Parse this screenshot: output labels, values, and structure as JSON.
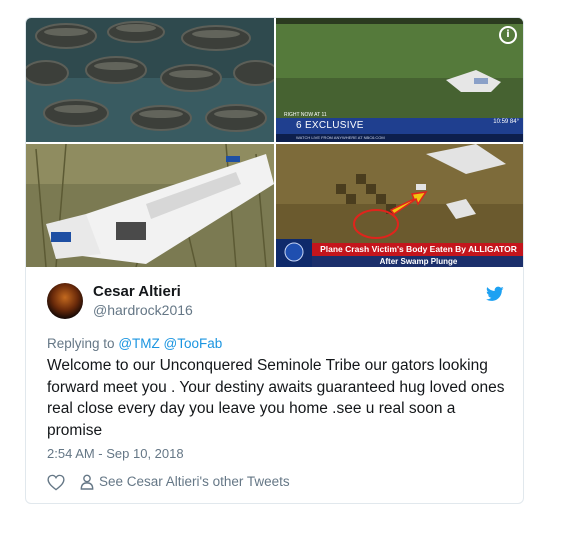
{
  "media": {
    "images": [
      {
        "icon": "alligators-photo"
      },
      {
        "icon": "swamp-crash-aerial-photo"
      },
      {
        "icon": "plane-wreck-photo"
      },
      {
        "icon": "crash-site-pixelated-photo"
      }
    ],
    "info_icon": "i",
    "news_bug": "6 EXCLUSIVE",
    "news_top": "RIGHT NOW AT 11",
    "news_sub": "WATCH LIVE FROM ANYWHERE AT NBC6.COM",
    "news_clock": "10:59  84°",
    "banner_headline": "Plane Crash Victim's Body Eaten By ALLIGATOR",
    "banner_sub": "After Swamp Plunge"
  },
  "tweet": {
    "name": "Cesar Altieri",
    "handle": "@hardrock2016",
    "replying_prefix": "Replying to",
    "replying_to_1": "@TMZ",
    "replying_to_2": "@TooFab",
    "text": "Welcome to our Unconquered Seminole Tribe our gators looking forward meet you . Your destiny awaits guaranteed hug loved ones real close every day you leave you home .see u real soon a promise",
    "timestamp": "2:54 AM - Sep 10, 2018",
    "other_tweets": "See Cesar Altieri's other Tweets"
  },
  "colors": {
    "twitter_blue": "#1da1f2",
    "link_blue": "#1b95e0",
    "muted": "#657786",
    "news_red": "#c4151c"
  }
}
